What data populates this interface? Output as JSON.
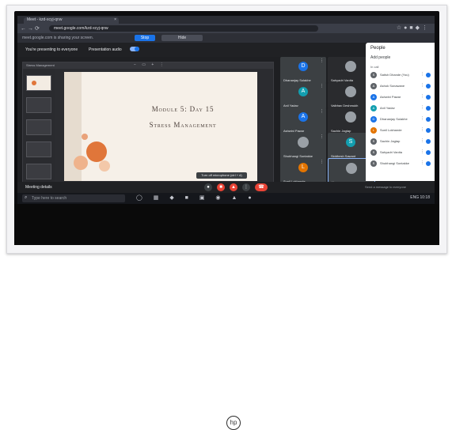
{
  "browser": {
    "tab_title": "Meet - kzd-xcyj-qnw",
    "url": "meet.google.com/kzd-xcyj-qnw",
    "infobar_text": "meet.google.com is sharing your screen.",
    "infobar_primary": "Stop",
    "infobar_secondary": "Hide"
  },
  "meet": {
    "presenting_text": "You're presenting to everyone",
    "presentation_audio_label": "Presentation audio",
    "presentation_audio_on": true
  },
  "presentation": {
    "header": "Stress Management",
    "slide_title_1": "Module 5: Day 15",
    "slide_title_2": "Stress Management",
    "accent_color": "#e0763a"
  },
  "participants": [
    {
      "name": "Dhananjay Sulakhe",
      "initial": "D",
      "color": "#1a73e8",
      "kind": "avatar",
      "dark": false
    },
    {
      "name": "Sahyadri Vanita",
      "initial": "",
      "color": "#9aa0a6",
      "kind": "photo",
      "dark": true
    },
    {
      "name": "Anil Yadav",
      "initial": "A",
      "color": "#129eaf",
      "kind": "avatar",
      "dark": false
    },
    {
      "name": "Vaibhav Deshmukh",
      "initial": "",
      "color": "#9aa0a6",
      "kind": "photo",
      "dark": true
    },
    {
      "name": "Ashwini Pawar",
      "initial": "A",
      "color": "#1a73e8",
      "kind": "avatar",
      "dark": false
    },
    {
      "name": "Sachin Jagtap",
      "initial": "",
      "color": "#9aa0a6",
      "kind": "photo",
      "dark": true
    },
    {
      "name": "Shubhangi Sontakke",
      "initial": "",
      "color": "#9aa0a6",
      "kind": "photo",
      "dark": false
    },
    {
      "name": "Siddhesh Sawant",
      "initial": "S",
      "color": "#129eaf",
      "kind": "avatar",
      "dark": false
    },
    {
      "name": "Sunil Lokhande",
      "initial": "L",
      "color": "#e37400",
      "kind": "avatar",
      "dark": false
    },
    {
      "name": "You",
      "initial": "",
      "color": "#9aa0a6",
      "kind": "photo",
      "dark": false
    }
  ],
  "people_panel": {
    "title": "People",
    "add_people": "Add people",
    "section": "In call",
    "people": [
      {
        "name": "Satish Dhande (You)",
        "initial": "S",
        "color": "#5f6368"
      },
      {
        "name": "Ashok Sonawane",
        "initial": "A",
        "color": "#5f6368"
      },
      {
        "name": "Ashwini Pawar",
        "initial": "A",
        "color": "#1a73e8"
      },
      {
        "name": "Anil Yadav",
        "initial": "A",
        "color": "#129eaf"
      },
      {
        "name": "Dhananjay Sulakhe",
        "initial": "D",
        "color": "#1a73e8"
      },
      {
        "name": "Sunil Lokhande",
        "initial": "L",
        "color": "#e37400"
      },
      {
        "name": "Sachin Jagtap",
        "initial": "S",
        "color": "#5f6368"
      },
      {
        "name": "Sahyadri Vanita",
        "initial": "S",
        "color": "#5f6368"
      },
      {
        "name": "Shubhangi Sontakke",
        "initial": "S",
        "color": "#5f6368"
      }
    ]
  },
  "controls": {
    "meeting_details": "Meeting details",
    "tooltip": "Turn off microphone (ctrl + d)",
    "chat_placeholder": "Send a message to everyone"
  },
  "taskbar": {
    "search_placeholder": "Type here to search",
    "tray_text": "ENG 10:18"
  }
}
